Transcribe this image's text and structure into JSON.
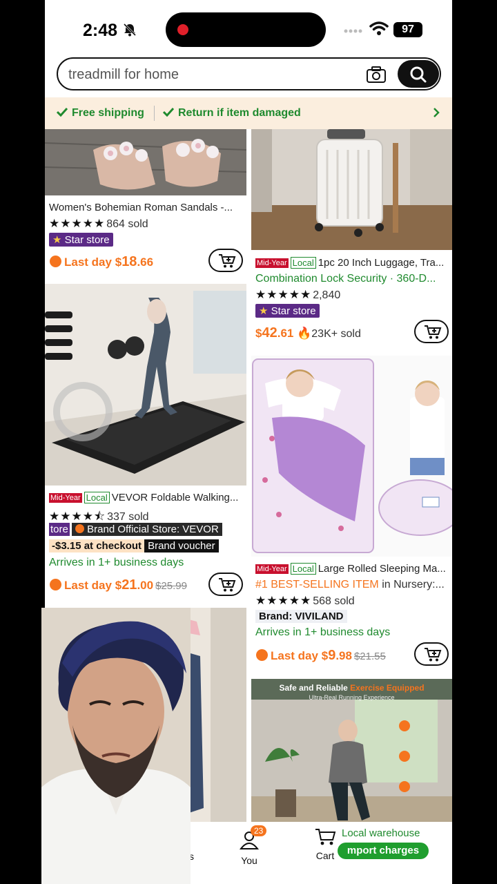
{
  "status": {
    "time": "2:48",
    "battery": "97"
  },
  "search": {
    "query": "treadmill for home"
  },
  "banner": {
    "item1": "Free shipping",
    "item2": "Return if item damaged"
  },
  "products": {
    "p1": {
      "title": "Women's Bohemian Roman Sandals -...",
      "sold": "864 sold",
      "badge": "Star store",
      "price_prefix": "Last day",
      "price_symbol": "$",
      "price_int": "18",
      "price_dec": ".66",
      "rating": 5
    },
    "p2": {
      "tag_mid": "Mid-Year",
      "tag_local": "Local",
      "title1": "1pc 20 Inch Luggage, Tra...",
      "title2": "Combination Lock Security · 360-D...",
      "sold": "2,840",
      "badge": "Star store",
      "price_symbol": "$",
      "price_int": "42",
      "price_dec": ".61",
      "sold2": "23K+ sold",
      "rating": 5
    },
    "p3": {
      "tag_mid": "Mid-Year",
      "tag_local": "Local",
      "title": "VEVOR Foldable Walking...",
      "sold": "337 sold",
      "store_prefix": "tore",
      "brand_store": "Brand Official Store: VEVOR",
      "coupon_a": "-$3.15 at checkout",
      "coupon_b": "Brand voucher",
      "arrives": "Arrives in 1+ business days",
      "price_prefix": "Last day",
      "price_symbol": "$",
      "price_int": "21",
      "price_dec": ".00",
      "old_price": "$25.99",
      "rating": 4.5
    },
    "p4": {
      "tag_mid": "Mid-Year",
      "tag_local": "Local",
      "title": "Large Rolled Sleeping Ma...",
      "best": "#1 BEST-SELLING ITEM",
      "best_suffix": "in Nursery:...",
      "sold": "568 sold",
      "brand": "Brand: VIVILAND",
      "arrives": "Arrives in 1+ business days",
      "price_prefix": "Last day",
      "price_symbol": "$",
      "price_int": "9",
      "price_dec": ".98",
      "old_price": "$21.55",
      "rating": 5
    },
    "p6": {
      "img_headline": "Safe and Reliable",
      "img_headline_accent": "Exercise Equipped",
      "img_sub": "Ultra-Real Running Experience"
    }
  },
  "nav": {
    "you_label": "You",
    "you_badge": "23",
    "cart_label": "Cart",
    "local_warehouse": "Local warehouse",
    "import_charges": "mport charges",
    "fragment": "s"
  },
  "colors": {
    "accent_orange": "#f5741e",
    "green": "#1f8a2e",
    "star_store": "#5b2a86",
    "mid_year": "#c8102e"
  }
}
